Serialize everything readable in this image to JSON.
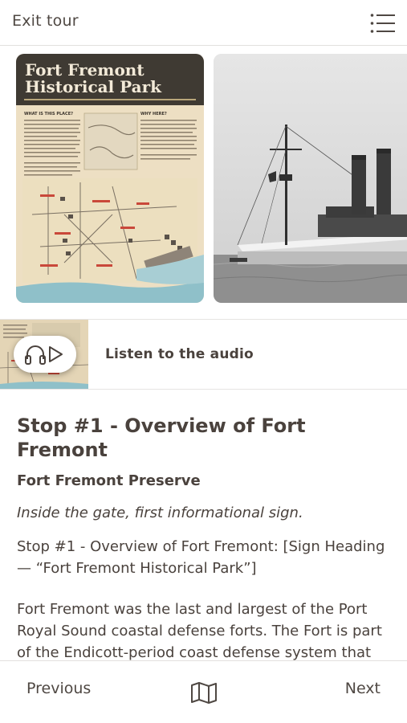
{
  "header": {
    "exit_label": "Exit tour",
    "menu_icon": "list-menu-icon"
  },
  "gallery": {
    "sign": {
      "title_line1": "Fort Fremont",
      "title_line2": "Historical Park",
      "section_left": "WHAT IS THIS PLACE?",
      "section_right": "WHY HERE?"
    }
  },
  "audio": {
    "label": "Listen to the audio",
    "icons": [
      "headphones-icon",
      "play-icon"
    ]
  },
  "stop": {
    "title": "Stop #1 - Overview of Fort Fremont",
    "subtitle": "Fort Fremont Preserve",
    "note": "Inside the gate, first informational sign.",
    "paragraphs": [
      "Stop #1 - Overview of Fort Fremont: [Sign Heading — “Fort Fremont Historical Park”]",
      "Fort Fremont was the last and largest of the Port Royal Sound coastal defense forts. The Fort is part of the Endicott-period coast defense system that provided state-of-the-art defense from roughly"
    ]
  },
  "footer": {
    "previous_label": "Previous",
    "next_label": "Next",
    "map_icon": "map-icon"
  },
  "colors": {
    "text": "#4a423d",
    "sign_header": "#3f3a33",
    "divider": "#e2e0de"
  }
}
